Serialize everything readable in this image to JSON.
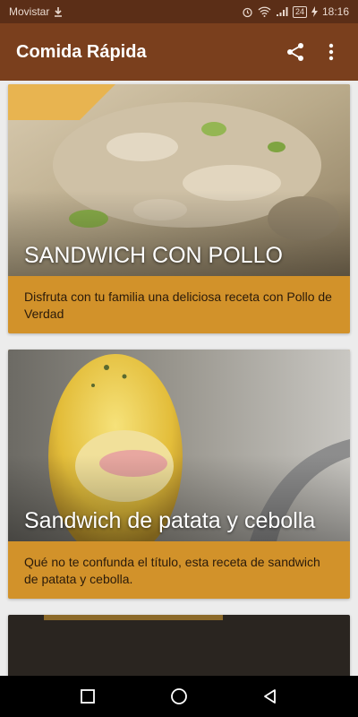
{
  "status_bar": {
    "carrier": "Movistar",
    "battery": "24",
    "time": "18:16",
    "icons": [
      "download-icon",
      "alarm-icon",
      "wifi-icon",
      "signal-icon",
      "charging-icon"
    ]
  },
  "app_bar": {
    "title": "Comida Rápida",
    "actions": [
      "share-icon",
      "more-vert-icon"
    ]
  },
  "colors": {
    "status_bar": "#5b2e17",
    "app_bar": "#7a3f1d",
    "card_background": "#d2922a",
    "background": "#ececec"
  },
  "recipes": [
    {
      "title": "SANDWICH CON POLLO",
      "description": "Disfruta con tu familia una deliciosa receta con Pollo de Verdad"
    },
    {
      "title": "Sandwich de patata y cebolla",
      "description": "Qué no te confunda el título, esta receta de sandwich de patata y cebolla."
    }
  ],
  "nav_bar": {
    "buttons": [
      "recents-square-icon",
      "home-circle-icon",
      "back-triangle-icon"
    ]
  }
}
